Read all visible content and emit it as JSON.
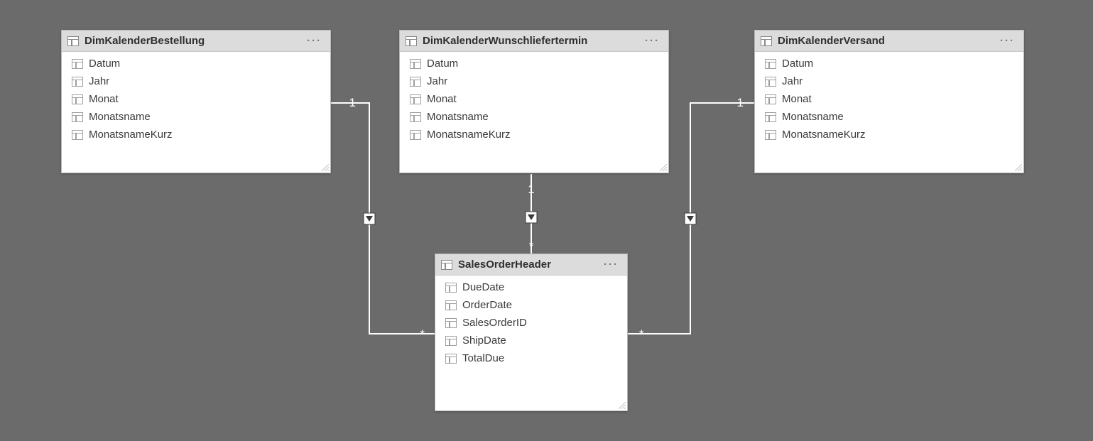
{
  "tables": {
    "dimKalenderBestellung": {
      "title": "DimKalenderBestellung",
      "fields": [
        "Datum",
        "Jahr",
        "Monat",
        "Monatsname",
        "MonatsnameKurz"
      ]
    },
    "dimKalenderWunschliefertermin": {
      "title": "DimKalenderWunschliefertermin",
      "fields": [
        "Datum",
        "Jahr",
        "Monat",
        "Monatsname",
        "MonatsnameKurz"
      ]
    },
    "dimKalenderVersand": {
      "title": "DimKalenderVersand",
      "fields": [
        "Datum",
        "Jahr",
        "Monat",
        "Monatsname",
        "MonatsnameKurz"
      ]
    },
    "salesOrderHeader": {
      "title": "SalesOrderHeader",
      "fields": [
        "DueDate",
        "OrderDate",
        "SalesOrderID",
        "ShipDate",
        "TotalDue"
      ]
    }
  },
  "relationships": {
    "left": {
      "from_card": "1",
      "to_card": "*"
    },
    "middle": {
      "from_card": "1",
      "to_card": "*"
    },
    "right": {
      "from_card": "1",
      "to_card": "*"
    }
  },
  "chart_data": {
    "type": "entity-relationship",
    "entities": [
      {
        "name": "DimKalenderBestellung",
        "fields": [
          "Datum",
          "Jahr",
          "Monat",
          "Monatsname",
          "MonatsnameKurz"
        ]
      },
      {
        "name": "DimKalenderWunschliefertermin",
        "fields": [
          "Datum",
          "Jahr",
          "Monat",
          "Monatsname",
          "MonatsnameKurz"
        ]
      },
      {
        "name": "DimKalenderVersand",
        "fields": [
          "Datum",
          "Jahr",
          "Monat",
          "Monatsname",
          "MonatsnameKurz"
        ]
      },
      {
        "name": "SalesOrderHeader",
        "fields": [
          "DueDate",
          "OrderDate",
          "SalesOrderID",
          "ShipDate",
          "TotalDue"
        ]
      }
    ],
    "relationships": [
      {
        "from": "DimKalenderBestellung",
        "to": "SalesOrderHeader",
        "cardinality": "1:*",
        "filter_direction": "single"
      },
      {
        "from": "DimKalenderWunschliefertermin",
        "to": "SalesOrderHeader",
        "cardinality": "1:*",
        "filter_direction": "single"
      },
      {
        "from": "DimKalenderVersand",
        "to": "SalesOrderHeader",
        "cardinality": "1:*",
        "filter_direction": "single"
      }
    ]
  }
}
